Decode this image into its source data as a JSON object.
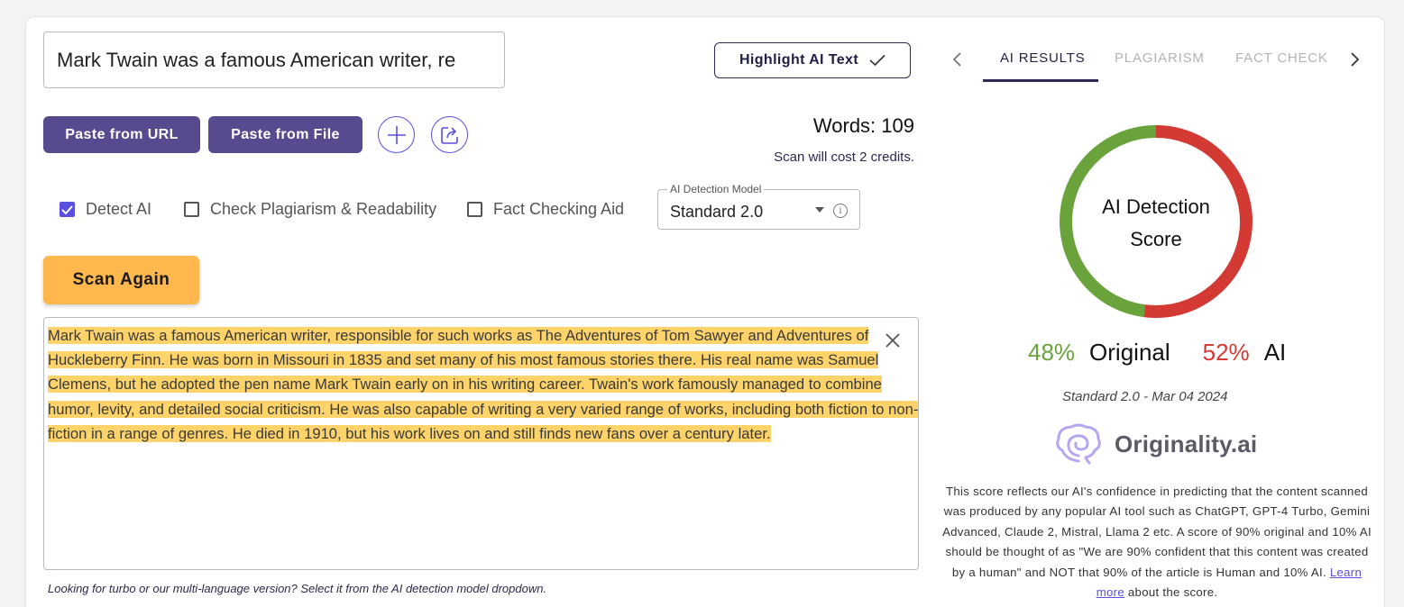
{
  "editor": {
    "title_value": "Mark Twain was a famous American writer, re",
    "highlight_label": "Highlight AI Text",
    "paste_url_label": "Paste from URL",
    "paste_file_label": "Paste from File",
    "words_label": "Words: 109",
    "credits_text": "Scan will cost 2 credits.",
    "options": [
      {
        "label": "Detect AI",
        "checked": true
      },
      {
        "label": "Check Plagiarism & Readability",
        "checked": false
      },
      {
        "label": "Fact Checking Aid",
        "checked": false
      }
    ],
    "model_select": {
      "label": "AI Detection Model",
      "value": "Standard 2.0"
    },
    "scan_label": "Scan Again",
    "body_text": "Mark Twain was a famous American writer, responsible for such works as The Adventures of Tom Sawyer and Adventures of Huckleberry Finn. He was born in Missouri in 1835 and set many of his most famous stories there. His real name was Samuel Clemens, but he adopted the pen name Mark Twain early on in his writing career. Twain's work famously managed to combine humor, levity, and detailed social criticism. He was also capable of writing a very varied range of works, including both fiction to non-fiction in a range of genres. He died in 1910, but his work lives on and still finds new fans over a century later.",
    "hint": "Looking for turbo or our multi-language version? Select it from the AI detection model dropdown."
  },
  "results": {
    "tabs": [
      "AI RESULTS",
      "PLAGIARISM",
      "FACT CHECK"
    ],
    "active_tab": 0,
    "donut_label": "AI Detection Score",
    "original_pct": "48%",
    "original_label": "Original",
    "ai_pct": "52%",
    "ai_label": "AI",
    "original_fraction": 0.48,
    "ai_fraction": 0.52,
    "model_date": "Standard 2.0 - Mar 04 2024",
    "brand": "Originality.ai",
    "description_prefix": "This score reflects our AI's confidence in predicting that the content scanned was produced by any popular AI tool such as ChatGPT, GPT-4 Turbo, Gemini Advanced, Claude 2, Mistral, Llama 2 etc. A score of 90% original and 10% AI should be thought of as \"We are 90% confident that this content was created by a human\" and NOT that 90% of the article is Human and 10% AI.",
    "learn_more": "Learn more",
    "description_suffix": "about the score."
  },
  "colors": {
    "purple": "#574a8f",
    "accent": "#5b4fe0",
    "orange": "#ffb84d",
    "highlight": "#fdd36a",
    "green": "#6aa33b",
    "red": "#d33a33"
  },
  "icons": [
    "check-icon",
    "plus-icon",
    "share-icon",
    "checkbox-checked-icon",
    "checkbox-icon",
    "dropdown-caret-icon",
    "info-icon",
    "close-icon",
    "chevron-left-icon",
    "chevron-right-icon",
    "brain-logo-icon"
  ]
}
